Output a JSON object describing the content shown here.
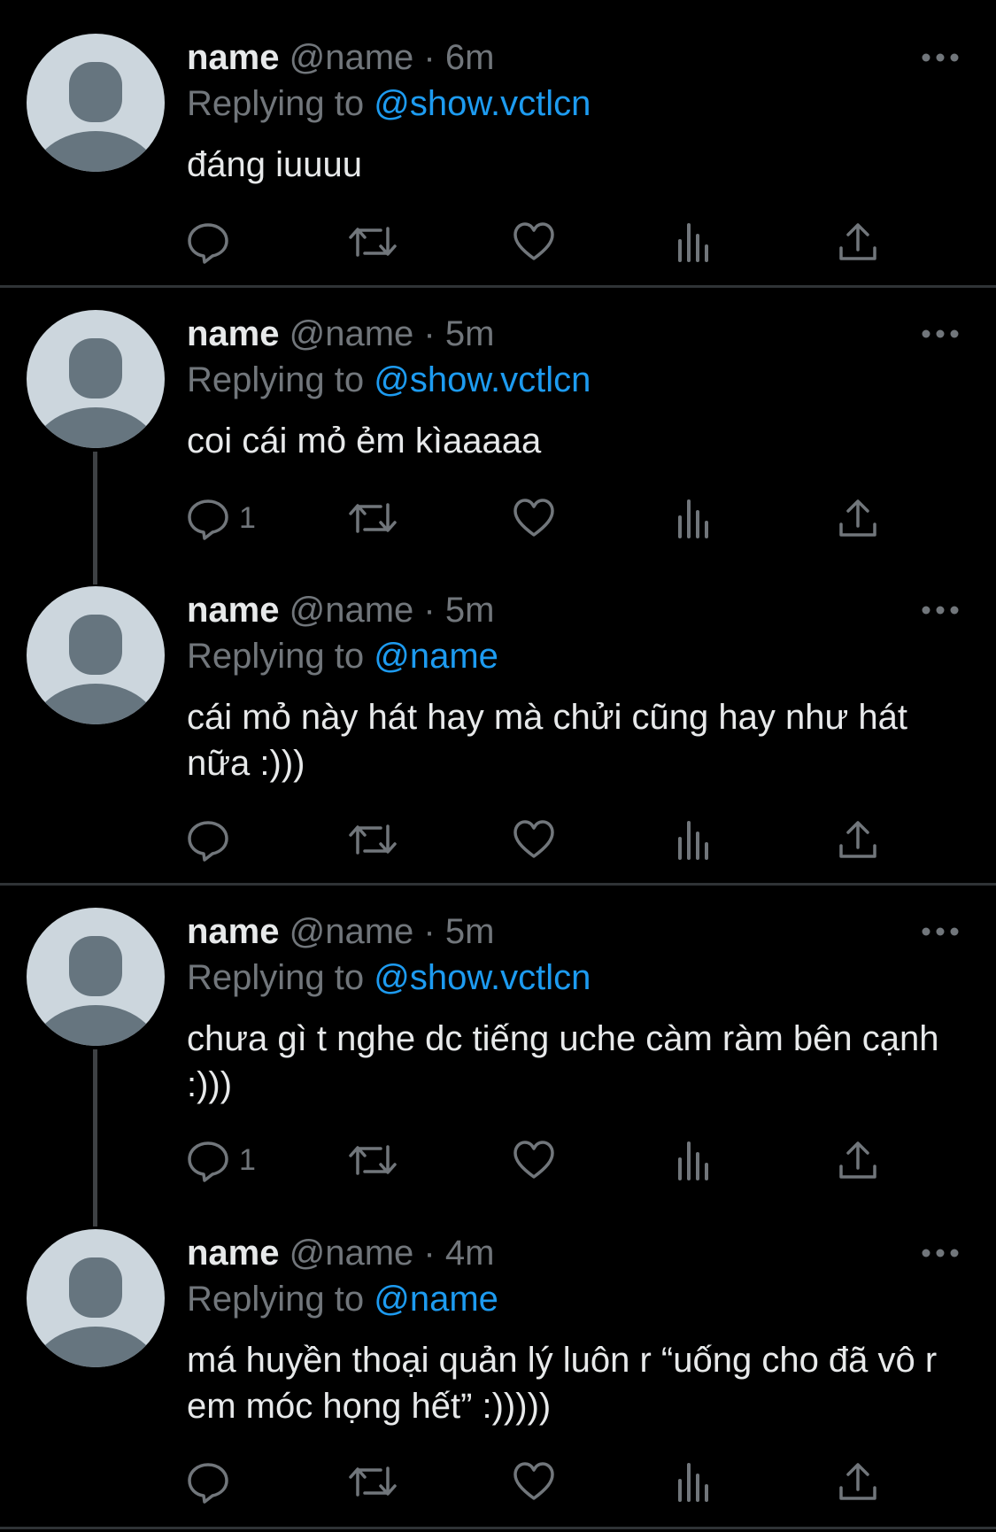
{
  "tweets": [
    {
      "name": "name",
      "handle": "@name",
      "dot": "·",
      "time": "6m",
      "replying_prefix": "Replying to ",
      "replying_to": "@show.vctlcn",
      "text": "đáng iuuuu",
      "reply_count": ""
    },
    {
      "name": "name",
      "handle": "@name",
      "dot": "·",
      "time": "5m",
      "replying_prefix": "Replying to ",
      "replying_to": "@show.vctlcn",
      "text": "coi cái mỏ ẻm kìaaaaa",
      "reply_count": "1"
    },
    {
      "name": "name",
      "handle": "@name",
      "dot": "·",
      "time": "5m",
      "replying_prefix": "Replying to ",
      "replying_to": "@name",
      "text": "cái mỏ này hát hay mà chửi cũng hay như hát nữa :)))",
      "reply_count": ""
    },
    {
      "name": "name",
      "handle": "@name",
      "dot": "·",
      "time": "5m",
      "replying_prefix": "Replying to ",
      "replying_to": "@show.vctlcn",
      "text": "chưa gì t nghe dc tiếng uche càm ràm bên cạnh :)))",
      "reply_count": "1"
    },
    {
      "name": "name",
      "handle": "@name",
      "dot": "·",
      "time": "4m",
      "replying_prefix": "Replying to ",
      "replying_to": "@name",
      "text": "má huyền thoại quản lý luôn r “uống cho đã vô r em móc họng hết” :)))))",
      "reply_count": ""
    }
  ],
  "colors": {
    "background": "#000000",
    "text": "#e7e9ea",
    "secondary": "#71767b",
    "accent": "#1d9bf0",
    "divider": "#2f3336",
    "avatar_bg": "#ccd6dd",
    "avatar_fg": "#66757f"
  },
  "icons": [
    "more-icon",
    "reply-icon",
    "retweet-icon",
    "like-icon",
    "views-icon",
    "share-icon"
  ]
}
